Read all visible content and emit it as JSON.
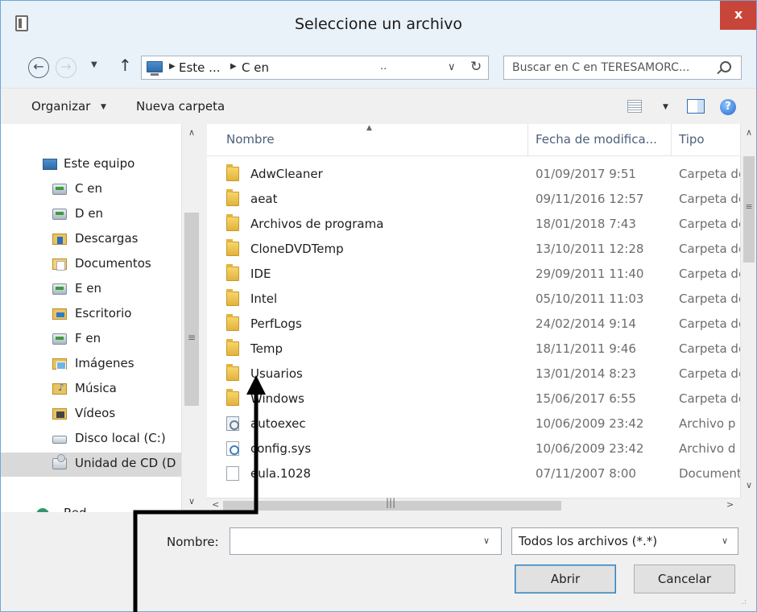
{
  "window": {
    "title": "Seleccione un archivo",
    "close_glyph": "x"
  },
  "address": {
    "crumbs": [
      "Este ...",
      "C en"
    ],
    "dots": "..",
    "search_placeholder": "Buscar en C en TERESAMORC..."
  },
  "toolbar": {
    "organize": "Organizar",
    "new_folder": "Nueva carpeta",
    "help_glyph": "?"
  },
  "nav": {
    "items": [
      {
        "label": "Este equipo",
        "icon": "pc-icon"
      },
      {
        "label": "C en",
        "icon": "network-drive-icon"
      },
      {
        "label": "D en",
        "icon": "network-drive-icon"
      },
      {
        "label": "Descargas",
        "icon": "downloads-icon"
      },
      {
        "label": "Documentos",
        "icon": "documents-icon"
      },
      {
        "label": "E en",
        "icon": "network-drive-icon"
      },
      {
        "label": "Escritorio",
        "icon": "desktop-icon"
      },
      {
        "label": "F en",
        "icon": "network-drive-icon"
      },
      {
        "label": "Imágenes",
        "icon": "pictures-icon"
      },
      {
        "label": "Música",
        "icon": "music-icon"
      },
      {
        "label": "Vídeos",
        "icon": "videos-icon"
      },
      {
        "label": "Disco local (C:)",
        "icon": "local-disk-icon"
      },
      {
        "label": "Unidad de CD (D",
        "icon": "cd-drive-icon"
      },
      {
        "label": "Red",
        "icon": "network-icon"
      }
    ]
  },
  "columns": {
    "name": "Nombre",
    "date": "Fecha de modifica...",
    "type": "Tipo"
  },
  "files": [
    {
      "name": "AdwCleaner",
      "date": "01/09/2017 9:51",
      "type": "Carpeta de",
      "icon": "folder-icon"
    },
    {
      "name": "aeat",
      "date": "09/11/2016 12:57",
      "type": "Carpeta de",
      "icon": "folder-icon"
    },
    {
      "name": "Archivos de programa",
      "date": "18/01/2018 7:43",
      "type": "Carpeta de",
      "icon": "folder-icon"
    },
    {
      "name": "CloneDVDTemp",
      "date": "13/10/2011 12:28",
      "type": "Carpeta de",
      "icon": "folder-icon"
    },
    {
      "name": "IDE",
      "date": "29/09/2011 11:40",
      "type": "Carpeta de",
      "icon": "folder-icon"
    },
    {
      "name": "Intel",
      "date": "05/10/2011 11:03",
      "type": "Carpeta de",
      "icon": "folder-icon"
    },
    {
      "name": "PerfLogs",
      "date": "24/02/2014 9:14",
      "type": "Carpeta de",
      "icon": "folder-icon"
    },
    {
      "name": "Temp",
      "date": "18/11/2011 9:46",
      "type": "Carpeta de",
      "icon": "folder-icon"
    },
    {
      "name": "Usuarios",
      "date": "13/01/2014 8:23",
      "type": "Carpeta de",
      "icon": "folder-icon"
    },
    {
      "name": "Windows",
      "date": "15/06/2017 6:55",
      "type": "Carpeta de",
      "icon": "folder-icon"
    },
    {
      "name": "autoexec",
      "date": "10/06/2009 23:42",
      "type": "Archivo p",
      "icon": "batch-file-icon"
    },
    {
      "name": "config.sys",
      "date": "10/06/2009 23:42",
      "type": "Archivo d",
      "icon": "system-file-icon"
    },
    {
      "name": "eula.1028",
      "date": "07/11/2007 8:00",
      "type": "Documento",
      "icon": "file-icon"
    }
  ],
  "footer": {
    "name_label": "Nombre:",
    "name_value": "",
    "filter_value": "Todos los archivos (*.*)",
    "open_label": "Abrir",
    "cancel_label": "Cancelar"
  },
  "colors": {
    "title_bg": "#e9f1f9",
    "close_bg": "#c8453a",
    "header_text": "#4c607a",
    "date_text": "#6d6d6d"
  }
}
